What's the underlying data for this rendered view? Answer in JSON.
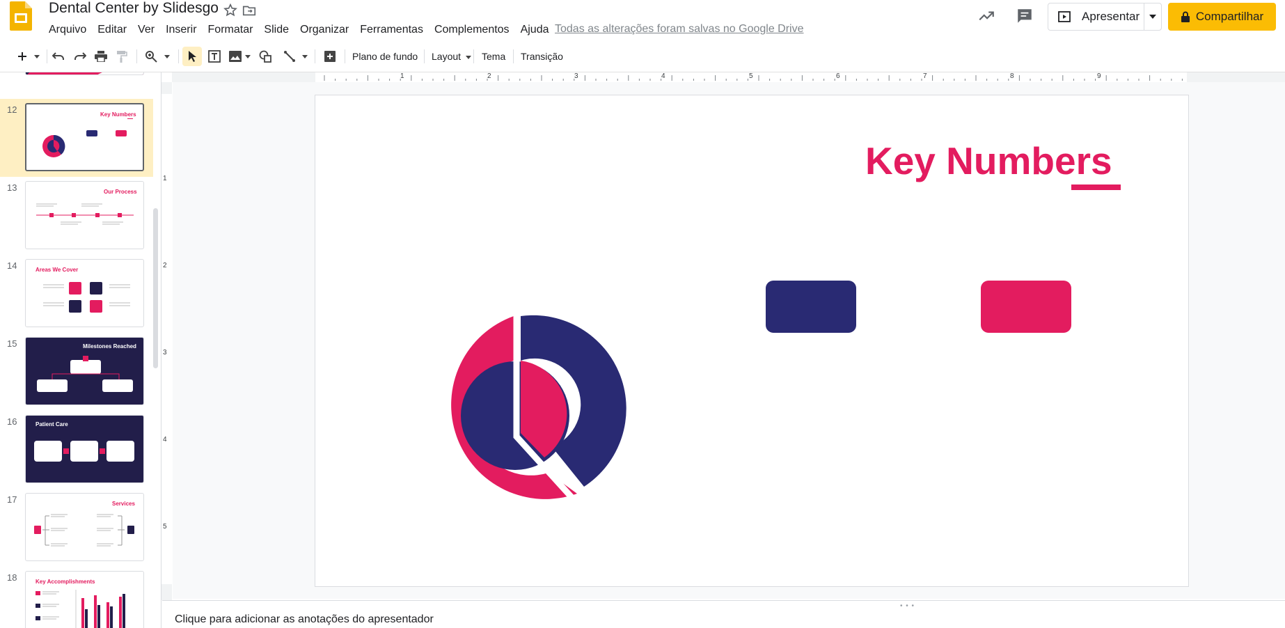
{
  "app": {
    "title": "Dental Center by Slidesgo",
    "menus": [
      "Arquivo",
      "Editar",
      "Ver",
      "Inserir",
      "Formatar",
      "Slide",
      "Organizar",
      "Ferramentas",
      "Complementos",
      "Ajuda"
    ],
    "saved_status": "Todas as alterações foram salvas no Google Drive",
    "present_label": "Apresentar",
    "share_label": "Compartilhar",
    "accent": "#fbbc04"
  },
  "toolbar": {
    "background_label": "Plano de fundo",
    "layout_label": "Layout",
    "theme_label": "Tema",
    "transition_label": "Transição"
  },
  "ruler": {
    "horizontal": [
      "1",
      "2",
      "3",
      "4",
      "5",
      "6",
      "7",
      "8",
      "9"
    ],
    "vertical": [
      "1",
      "2",
      "3",
      "4",
      "5"
    ]
  },
  "filmstrip": {
    "selected": "12",
    "slides": [
      {
        "num": "12",
        "title": "Key Numbers"
      },
      {
        "num": "13",
        "title": "Our Process"
      },
      {
        "num": "14",
        "title": "Areas We Cover"
      },
      {
        "num": "15",
        "title": "Milestones Reached"
      },
      {
        "num": "16",
        "title": "Patient Care"
      },
      {
        "num": "17",
        "title": "Services"
      },
      {
        "num": "18",
        "title": "Key Accomplishments"
      }
    ]
  },
  "slide": {
    "title": "Key Numbers",
    "colors": {
      "pink": "#e31c5f",
      "navy": "#292a73"
    }
  },
  "notes": {
    "placeholder": "Clique para adicionar as anotações do apresentador"
  }
}
